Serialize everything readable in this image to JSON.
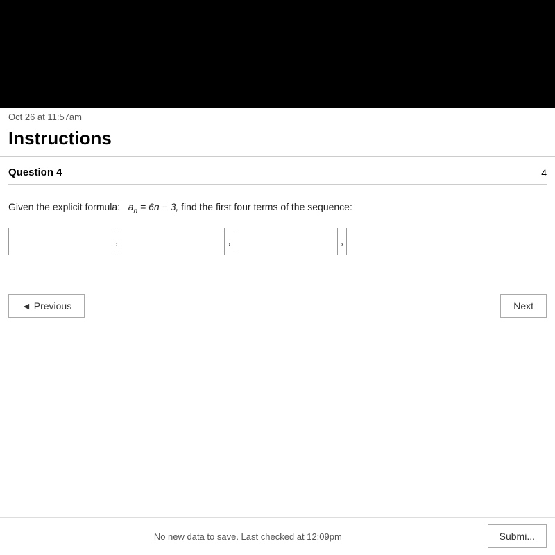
{
  "black_bar": {},
  "timestamp": "Oct 26 at 11:57am",
  "header": {
    "title": "Instructions"
  },
  "question": {
    "label": "Question 4",
    "points": "4",
    "body": "Given the explicit formula:",
    "formula_prefix": "a",
    "formula_sub": "n",
    "formula_body": " = 6n − 3,",
    "formula_suffix": " find the first four terms of the sequence:",
    "input_placeholders": [
      "",
      "",
      "",
      ""
    ]
  },
  "navigation": {
    "previous_label": "◄ Previous",
    "next_label": "Next"
  },
  "footer": {
    "status": "No new data to save. Last checked at 12:09pm",
    "submit_label": "Submi..."
  }
}
